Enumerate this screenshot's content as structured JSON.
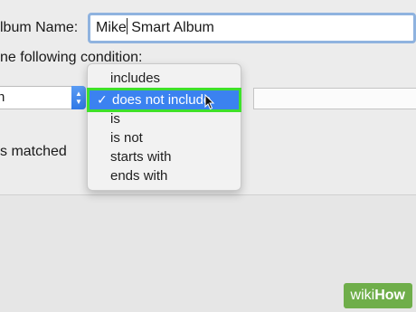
{
  "dialog": {
    "album_name_label": "lbum Name:",
    "album_name_value_before_caret": "Mike",
    "album_name_value_after_caret": " Smart Album",
    "condition_label": "ne following condition:",
    "field_popup_value": "n",
    "matched_label": "s matched"
  },
  "menu": {
    "items": [
      {
        "label": "includes"
      },
      {
        "label": "does not include",
        "selected": true
      },
      {
        "label": "is"
      },
      {
        "label": "is not"
      },
      {
        "label": "starts with"
      },
      {
        "label": "ends with"
      }
    ],
    "checkmark": "✓"
  },
  "watermark": {
    "prefix": "wiki",
    "suffix": "How"
  },
  "colors": {
    "selection": "#3b82f0",
    "highlight_outline": "#3fe12a",
    "field_focus": "#8fb3df",
    "watermark_bg": "#6fae4a"
  }
}
